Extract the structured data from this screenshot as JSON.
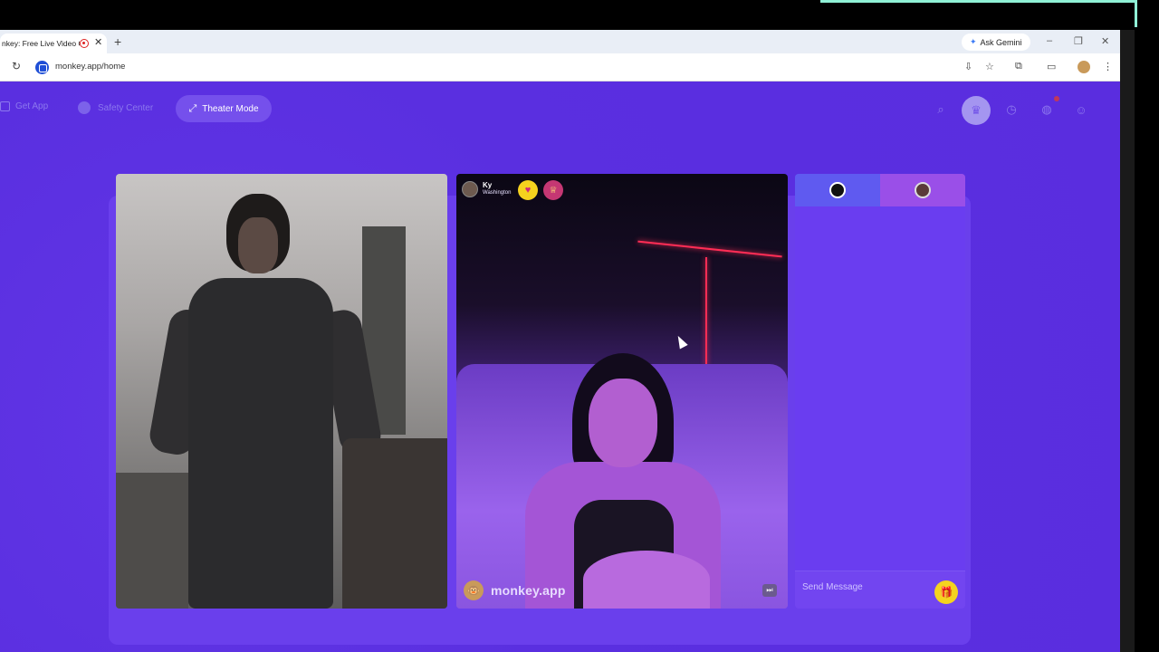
{
  "browser": {
    "tab_title": "nkey: Free Live Video Ch",
    "tab_close": "✕",
    "new_tab": "+",
    "gemini_label": "Ask Gemini",
    "url": "monkey.app/home",
    "window": {
      "minimize": "–",
      "restore": "❐",
      "close": "✕"
    }
  },
  "nav": {
    "get_app": "Get App",
    "safety_center": "Safety Center",
    "theater_mode": "Theater Mode"
  },
  "peer": {
    "name": "Ky",
    "location": "Washington"
  },
  "video": {
    "brand": "monkey.app"
  },
  "chat": {
    "placeholder": "Send Message"
  },
  "icons": {
    "search": "⌕",
    "crown": "♛",
    "history": "◷",
    "messages": "◍",
    "profile": "☺",
    "heart": "♥",
    "gift": "✚",
    "skip": "⏭",
    "expand": "⤢",
    "reload": "↻"
  },
  "colors": {
    "page_bg": "#5b2fe0",
    "accent": "#7550ec",
    "neon": "#ff2d55",
    "gift_yellow": "#f4d320"
  }
}
